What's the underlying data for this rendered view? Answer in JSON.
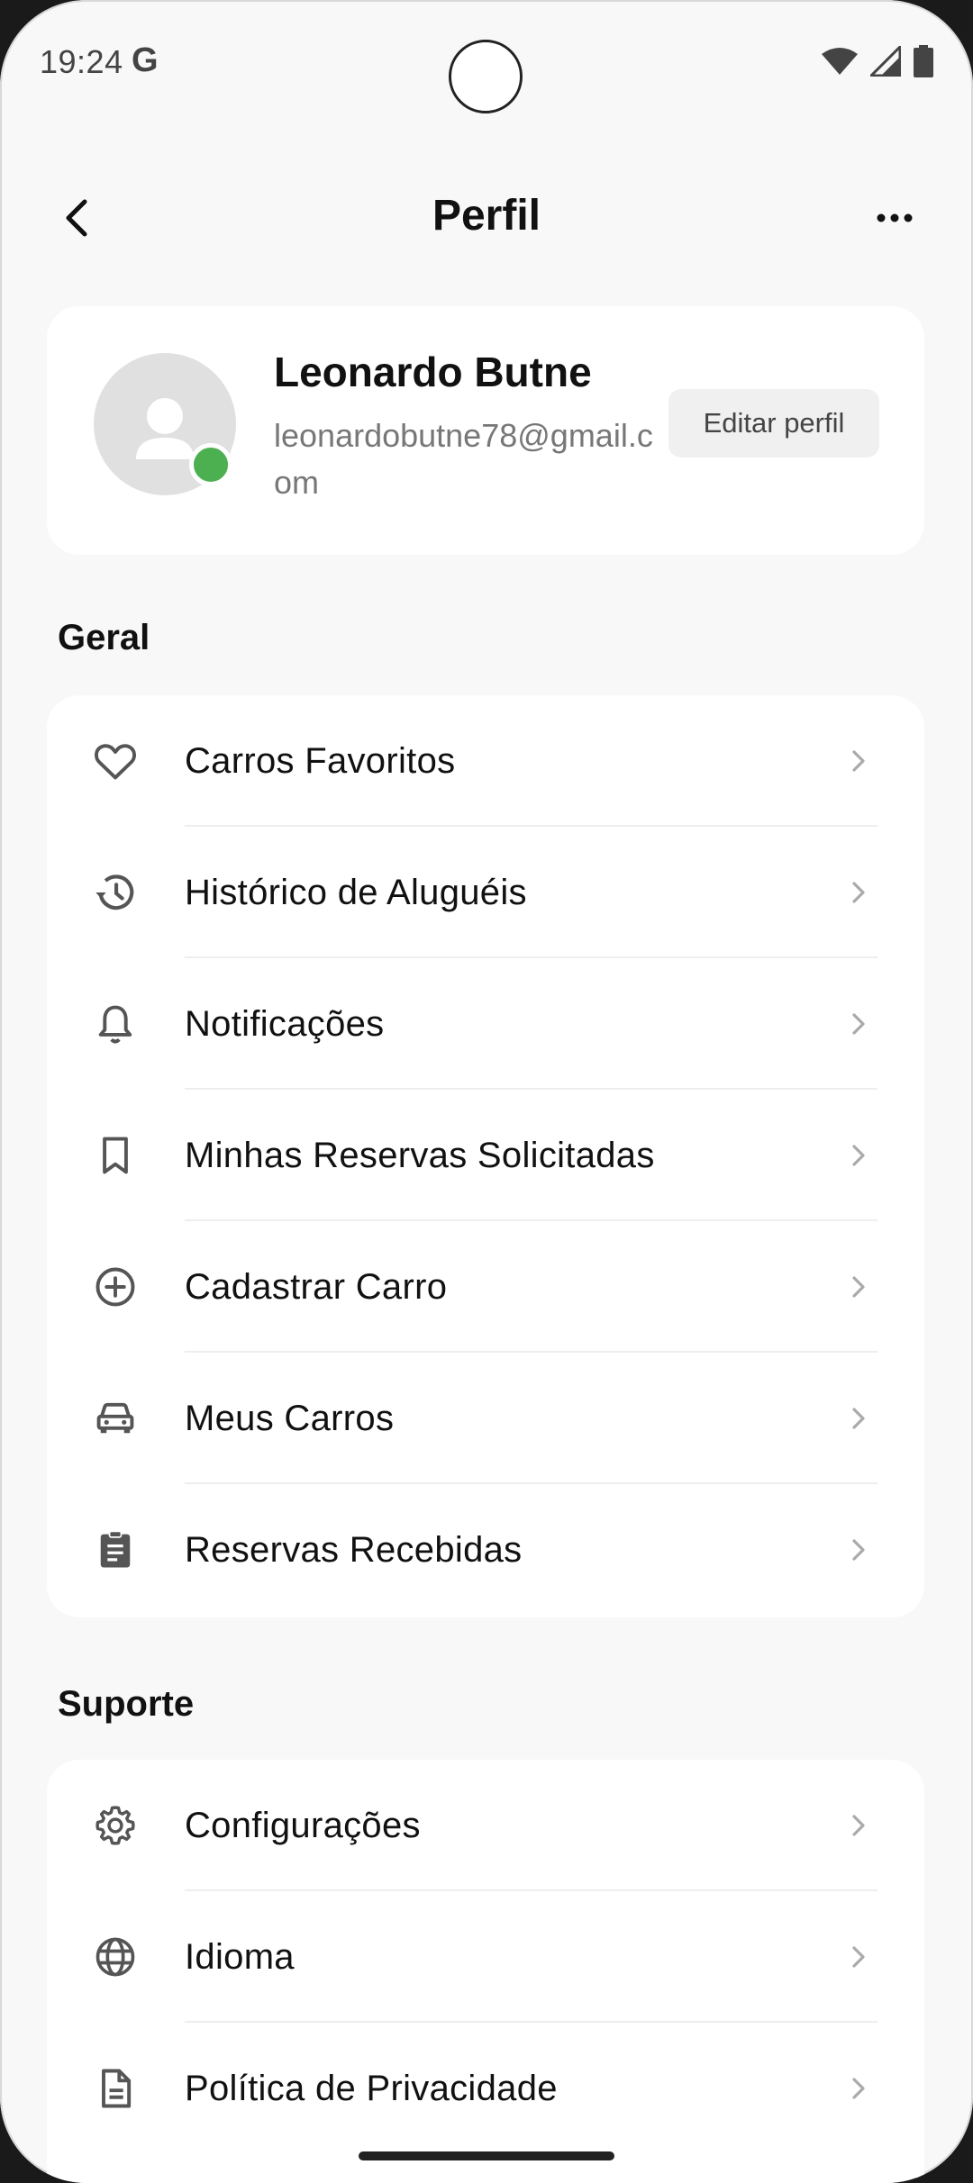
{
  "status_bar": {
    "time": "19:24",
    "g_logo": "G",
    "icons": [
      "wifi-icon",
      "signal-icon",
      "battery-icon"
    ]
  },
  "app_bar": {
    "title": "Perfil",
    "back_icon": "chevron-left-icon",
    "more_icon": "more-horizontal-icon"
  },
  "profile": {
    "name": "Leonardo Butne",
    "email": "leonardobutne78@gmail.com",
    "edit_label": "Editar perfil",
    "online": true,
    "status_color": "#4caf50"
  },
  "sections": {
    "general": {
      "title": "Geral",
      "items": [
        {
          "label": "Carros Favoritos",
          "icon": "heart-icon"
        },
        {
          "label": "Histórico de Aluguéis",
          "icon": "history-icon"
        },
        {
          "label": "Notificações",
          "icon": "bell-icon"
        },
        {
          "label": "Minhas Reservas Solicitadas",
          "icon": "bookmark-icon"
        },
        {
          "label": "Cadastrar Carro",
          "icon": "add-circle-icon"
        },
        {
          "label": "Meus Carros",
          "icon": "car-icon"
        },
        {
          "label": "Reservas Recebidas",
          "icon": "clipboard-icon"
        }
      ]
    },
    "support": {
      "title": "Suporte",
      "items": [
        {
          "label": "Configurações",
          "icon": "gear-icon"
        },
        {
          "label": "Idioma",
          "icon": "globe-icon"
        },
        {
          "label": "Política de Privacidade",
          "icon": "document-icon"
        }
      ]
    }
  }
}
